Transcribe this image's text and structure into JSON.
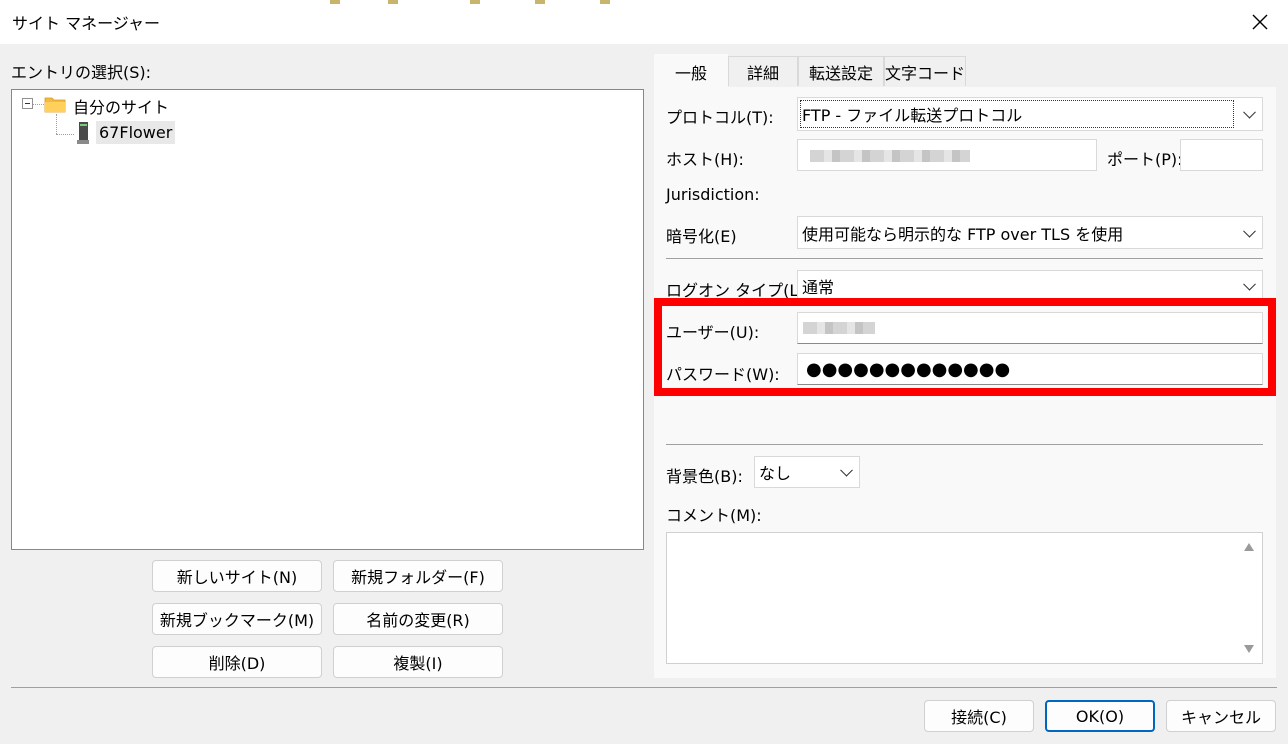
{
  "window": {
    "title": "サイト マネージャー",
    "close_icon": "×"
  },
  "left": {
    "entry_label": "エントリの選択(S):",
    "tree": {
      "root_label": "自分のサイト",
      "site_label": "67Flower"
    },
    "buttons": {
      "new_site": "新しいサイト(N)",
      "new_folder": "新規フォルダー(F)",
      "new_bookmark": "新規ブックマーク(M)",
      "rename": "名前の変更(R)",
      "delete": "削除(D)",
      "duplicate": "複製(I)"
    }
  },
  "tabs": [
    "一般",
    "詳細",
    "転送設定",
    "文字コード"
  ],
  "general": {
    "protocol_label": "プロトコル(T):",
    "protocol_value": "FTP - ファイル転送プロトコル",
    "host_label": "ホスト(H):",
    "port_label": "ポート(P):",
    "jurisdiction_label": "Jurisdiction:",
    "encryption_label": "暗号化(E)",
    "encryption_value": "使用可能なら明示的な FTP over TLS を使用",
    "logon_type_label": "ログオン タイプ(L):",
    "logon_type_value": "通常",
    "user_label": "ユーザー(U):",
    "password_label": "パスワード(W):",
    "password_value": "●●●●●●●●●●●●●",
    "bg_color_label": "背景色(B):",
    "bg_color_value": "なし",
    "comment_label": "コメント(M):"
  },
  "footer": {
    "connect": "接続(C)",
    "ok": "OK(O)",
    "cancel": "キャンセル"
  },
  "colors": {
    "highlight": "#ff0000",
    "folder": "#f4b942",
    "ok_border": "#0067c0"
  }
}
